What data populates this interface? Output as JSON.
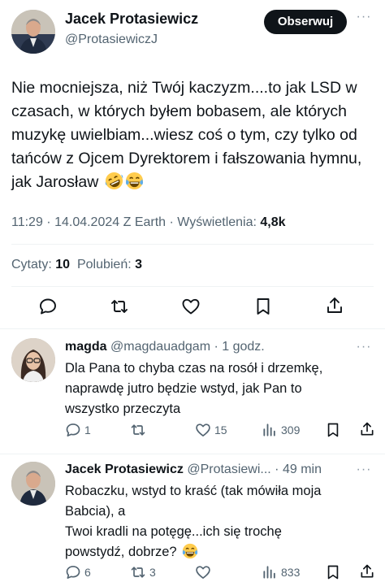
{
  "main_tweet": {
    "author_name": "Jacek Protasiewicz",
    "author_handle": "@ProtasiewiczJ",
    "follow_label": "Obserwuj",
    "text": "Nie mocniejsza, niż Twój kaczyzm....to jak LSD w czasach, w których byłem bobasem, ale których muzykę uwielbiam...wiesz coś o tym, czy tylko od tańców z Ojcem Dyrektorem i fałszowania hymnu, jak Jarosław",
    "emojis": [
      "rolling-on-floor-laughing-emoji",
      "face-with-tears-of-joy-emoji"
    ],
    "meta": "11:29 · 14.04.2024 Z Earth · Wyświetlenia: ",
    "views": "4,8k",
    "quotes_label": "Cytaty:",
    "quotes_count": "10",
    "likes_label": "Polubień:",
    "likes_count": "3",
    "actions": [
      "reply-icon",
      "retweet-icon",
      "like-icon",
      "bookmark-icon",
      "share-icon"
    ]
  },
  "replies": [
    {
      "name": "magda",
      "handle": "@magdauadgam",
      "time": "· 1 godz.",
      "text_lines": [
        "Dla Pana to chyba czas na rosół i drzemkę,",
        "naprawdę jutro będzie wstyd, jak Pan to",
        "wszystko przeczyta"
      ],
      "replies": "1",
      "retweets": "",
      "likes": "15",
      "views": "309"
    },
    {
      "name": "Jacek Protasiewicz",
      "handle": "@Protasiewi...",
      "time": "· 49 min",
      "text_lines": [
        "Robaczku, wstyd to kraść (tak mówiła moja",
        "Babcia), a",
        "Twoi kradli na potęgę...ich się trochę",
        "powstydź, dobrze?"
      ],
      "replies": "6",
      "retweets": "3",
      "likes": "",
      "views": "833"
    }
  ],
  "colors": {
    "text": "#0f1419",
    "secondary": "#536471",
    "divider": "#eff3f4"
  }
}
